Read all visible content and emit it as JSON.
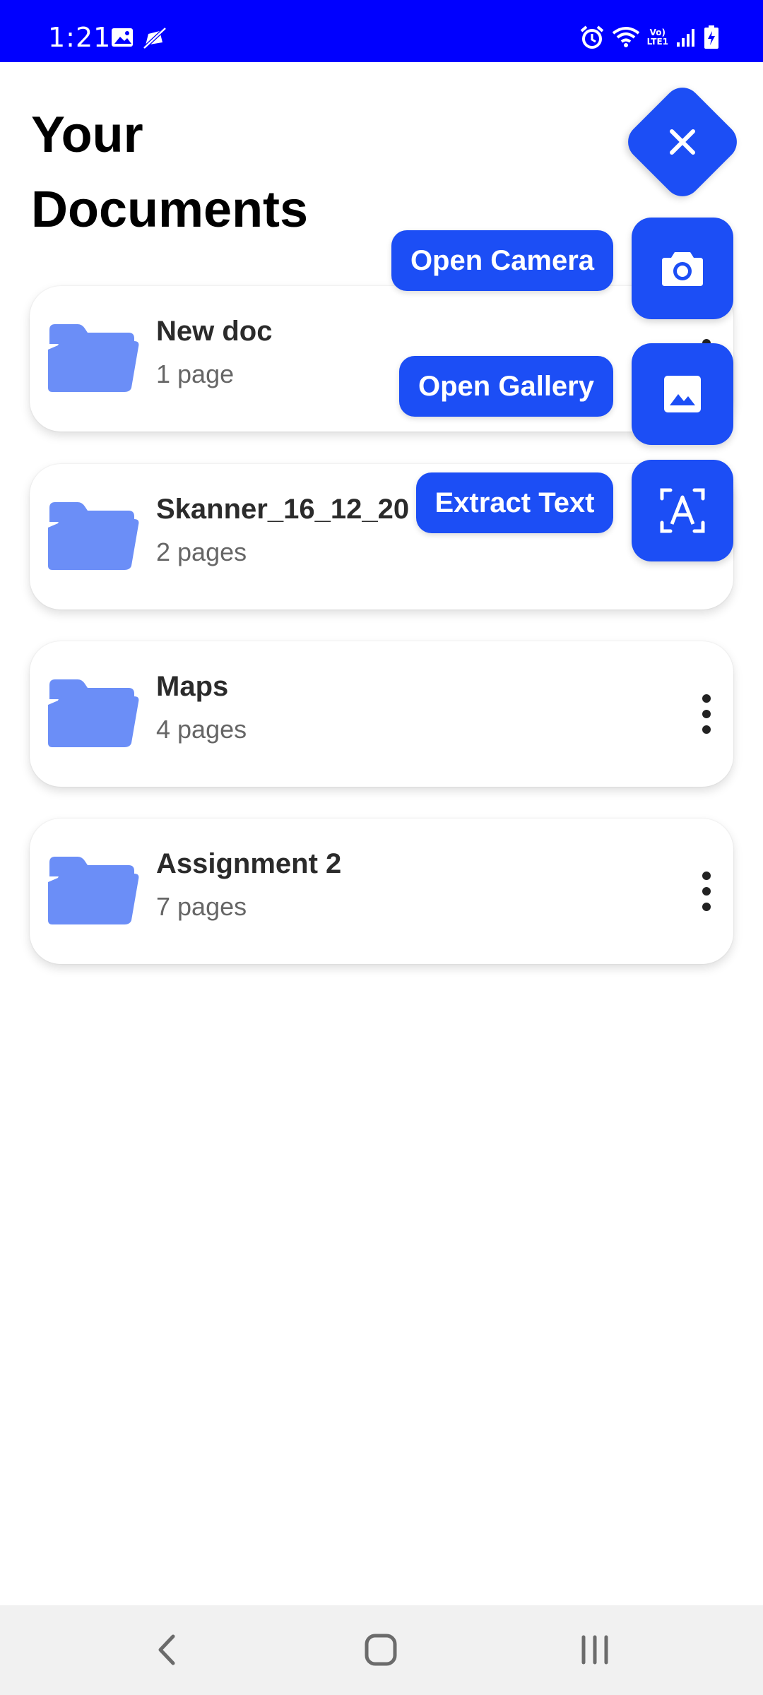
{
  "status_bar": {
    "time": "1:21",
    "lte_top": "Vo)",
    "lte_bottom": "LTE1",
    "background": "#0000ff",
    "icons_left": [
      "gallery-icon",
      "muted-icon"
    ],
    "icons_right": [
      "alarm-icon",
      "wifi-icon",
      "lte-icon",
      "signal-icon",
      "battery-charging-icon"
    ]
  },
  "header": {
    "title": "Your Documents"
  },
  "documents": [
    {
      "name": "New doc",
      "pages": "1 page"
    },
    {
      "name": "Skanner_16_12_20",
      "pages": "2 pages"
    },
    {
      "name": "Maps",
      "pages": "4 pages"
    },
    {
      "name": "Assignment 2",
      "pages": "7 pages"
    }
  ],
  "fab_menu": {
    "main_icon": "close-icon",
    "actions": [
      {
        "label": "Open Camera",
        "icon": "camera-icon"
      },
      {
        "label": "Open Gallery",
        "icon": "image-icon"
      },
      {
        "label": "Extract Text",
        "icon": "text-recognition-icon"
      }
    ]
  },
  "nav_bar": {
    "buttons": [
      "back-icon",
      "home-icon",
      "recents-icon"
    ]
  },
  "colors": {
    "accent": "#1c4ef5",
    "folder": "#6b8ef7",
    "status_bar": "#0000ff",
    "nav_bar": "#f1f1f1"
  }
}
